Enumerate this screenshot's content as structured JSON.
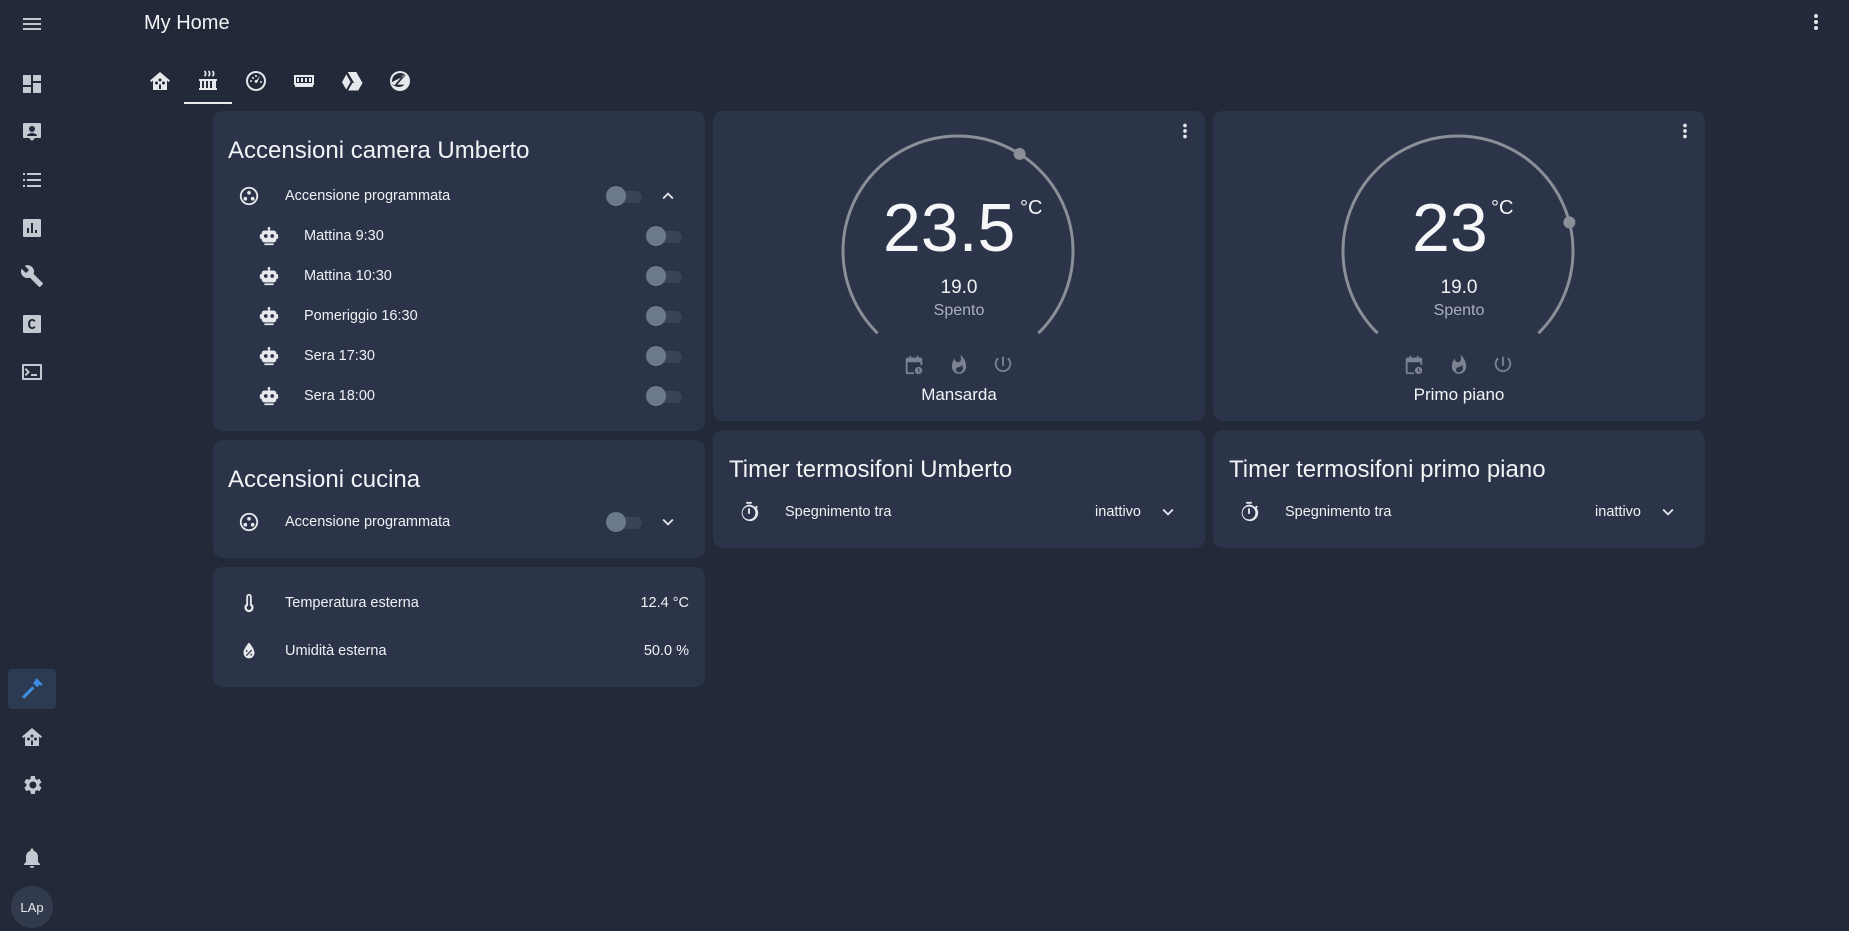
{
  "header": {
    "title": "My Home"
  },
  "user": {
    "initials": "LAp"
  },
  "colors": {
    "background": "#222a39",
    "card": "#2b3449",
    "accent": "#3d8fe6"
  },
  "sidebar": {
    "items": [
      {
        "name": "menu-icon"
      },
      {
        "name": "overview-icon"
      },
      {
        "name": "map-icon"
      },
      {
        "name": "logbook-icon"
      },
      {
        "name": "history-icon"
      },
      {
        "name": "tools-icon"
      },
      {
        "name": "code-icon"
      },
      {
        "name": "terminal-icon"
      },
      {
        "name": "hammer-icon",
        "active": true
      },
      {
        "name": "home-icon"
      },
      {
        "name": "settings-icon"
      },
      {
        "name": "notifications-icon"
      }
    ]
  },
  "tabs": [
    {
      "name": "home-icon"
    },
    {
      "name": "radiator-icon",
      "active": true
    },
    {
      "name": "gauge-icon"
    },
    {
      "name": "memory-icon"
    },
    {
      "name": "drive-icon"
    },
    {
      "name": "zigbee-icon"
    }
  ],
  "card_umberto": {
    "title": "Accensioni camera Umberto",
    "main_label": "Accensione programmata",
    "items": [
      {
        "label": "Mattina 9:30"
      },
      {
        "label": "Mattina 10:30"
      },
      {
        "label": "Pomeriggio 16:30"
      },
      {
        "label": "Sera 17:30"
      },
      {
        "label": "Sera 18:00"
      }
    ]
  },
  "card_cucina": {
    "title": "Accensioni cucina",
    "main_label": "Accensione programmata"
  },
  "sensors": {
    "temperature": {
      "label": "Temperatura esterna",
      "value": "12.4 °C"
    },
    "humidity": {
      "label": "Umidità esterna",
      "value": "50.0 %"
    }
  },
  "thermostats": [
    {
      "current": "23.5",
      "unit": "°C",
      "target": "19.0",
      "state": "Spento",
      "name": "Mansarda",
      "target_position": 0.62
    },
    {
      "current": "23",
      "unit": "°C",
      "target": "19.0",
      "state": "Spento",
      "name": "Primo piano",
      "target_position": 0.78
    }
  ],
  "timers": [
    {
      "title": "Timer termosifoni Umberto",
      "label": "Spegnimento tra",
      "value": "inattivo"
    },
    {
      "title": "Timer termosifoni primo piano",
      "label": "Spegnimento tra",
      "value": "inattivo"
    }
  ]
}
